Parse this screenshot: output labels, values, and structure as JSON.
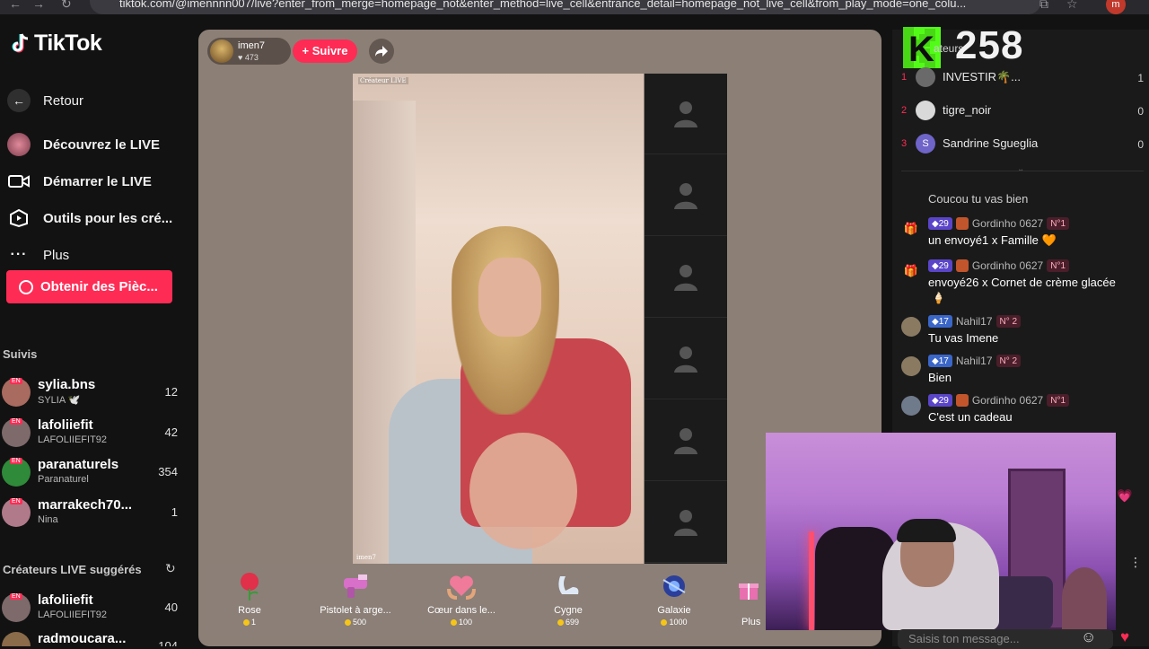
{
  "browser": {
    "url": "tiktok.com/@imennnn007/live?enter_from_merge=homepage_not&enter_method=live_cell&entrance_detail=homepage_not_live_cell&from_play_mode=one_colu...",
    "profile_initial": "m"
  },
  "sidebar": {
    "logo_text": "TikTok",
    "back_label": "Retour",
    "nav": [
      {
        "label": "Découvrez le LIVE",
        "icon": "avatar-icon"
      },
      {
        "label": "Démarrer le LIVE",
        "icon": "video-camera-icon"
      },
      {
        "label": "Outils pour les cré...",
        "icon": "play-tools-icon"
      },
      {
        "label": "Plus",
        "icon": "more-dots-icon"
      }
    ],
    "coins_button": "Obtenir des Pièc...",
    "following_title": "Suivis",
    "following": [
      {
        "name": "sylia.bns",
        "sub": "SYLIA 🕊️",
        "count": "12",
        "color": "#a96a5f"
      },
      {
        "name": "lafoliiefit",
        "sub": "LAFOLIIEFIT92",
        "count": "42",
        "color": "#7e6a6a"
      },
      {
        "name": "paranaturels",
        "sub": "Paranaturel",
        "count": "354",
        "color": "#2f8a3a"
      },
      {
        "name": "marrakech70...",
        "sub": "Nina",
        "count": "1",
        "color": "#b07a8a"
      }
    ],
    "suggested_title": "Créateurs LIVE suggérés",
    "suggested": [
      {
        "name": "lafoliiefit",
        "sub": "LAFOLIIEFIT92",
        "count": "40",
        "color": "#7e6a6a"
      },
      {
        "name": "radmoucara...",
        "sub": "",
        "count": "104",
        "color": "#8a6b4a"
      }
    ],
    "live_badge": "EN"
  },
  "stream": {
    "host_name": "imen7",
    "host_likes": "473",
    "follow_label": "+ Suivre",
    "video_tag_top": "Créateur LIVE",
    "video_tag_bottom": "imen7"
  },
  "gifts": [
    {
      "name": "Rose",
      "price": "1",
      "icon": "rose-icon",
      "color": "#e0304a"
    },
    {
      "name": "Pistolet à arge...",
      "price": "500",
      "icon": "money-gun-icon",
      "color": "#d86fc8"
    },
    {
      "name": "Cœur dans le...",
      "price": "100",
      "icon": "heart-hands-icon",
      "color": "#e3a57a"
    },
    {
      "name": "Cygne",
      "price": "699",
      "icon": "swan-icon",
      "color": "#dfe9f5"
    },
    {
      "name": "Galaxie",
      "price": "1000",
      "icon": "galaxy-icon",
      "color": "#4a7de0"
    }
  ],
  "gifts_more": "Plus",
  "kick": {
    "viewers": "258",
    "partial_label": "ateurs"
  },
  "ranking": [
    {
      "rank": "1",
      "name": "INVESTIR🌴...",
      "score": "1",
      "color": "#6a6a6a"
    },
    {
      "rank": "2",
      "name": "tigre_noir",
      "score": "0",
      "color": "#d9d9d9"
    },
    {
      "rank": "3",
      "name": "Sandrine Sgueglia",
      "score": "0",
      "color": "#6f64c8",
      "initial": "S"
    }
  ],
  "chat": [
    {
      "user": "",
      "text": "Coucou tu vas bien",
      "level": "",
      "rankb": "",
      "type": "partial"
    },
    {
      "user": "Gordinho 0627",
      "text": "un envoyé1 x Famille 🧡",
      "level": "29",
      "rankb": "N°1",
      "type": "gift"
    },
    {
      "user": "Gordinho 0627",
      "text": "envoyé26 x Cornet de crème glacée",
      "level": "29",
      "rankb": "N°1",
      "type": "gift"
    },
    {
      "user": "Nahil17",
      "text": "Tu vas Imene",
      "level": "17",
      "rankb": "N° 2",
      "type": "msg"
    },
    {
      "user": "Nahil17",
      "text": "Bien",
      "level": "17",
      "rankb": "N° 2",
      "type": "msg"
    },
    {
      "user": "Gordinho 0627",
      "text": "C'est un cadeau",
      "level": "29",
      "rankb": "N°1",
      "type": "msg"
    }
  ],
  "chat_input": {
    "placeholder": "Saisis ton message..."
  },
  "colors": {
    "accent": "#fe2c55",
    "kick_green": "#53fc18"
  }
}
